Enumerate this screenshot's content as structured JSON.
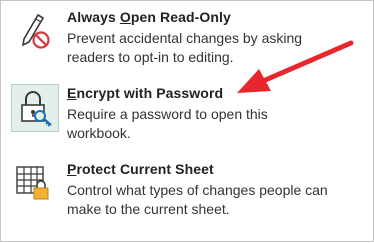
{
  "items": [
    {
      "title_before": "Always ",
      "title_underline": "O",
      "title_after": "pen Read-Only",
      "desc_line1": "Prevent accidental changes by asking",
      "desc_line2": "readers to opt-in to editing.",
      "icon": "pencil-no-icon"
    },
    {
      "title_before": "",
      "title_underline": "E",
      "title_after": "ncrypt with Password",
      "desc_line1": "Require a password to open this",
      "desc_line2": "workbook.",
      "icon": "padlock-key-icon",
      "selected": true
    },
    {
      "title_before": "",
      "title_underline": "P",
      "title_after": "rotect Current Sheet",
      "desc_line1": "Control what types of changes people can",
      "desc_line2": "make to the current sheet.",
      "icon": "sheet-lock-icon"
    }
  ],
  "colors": {
    "annotation_arrow": "#e8262b",
    "selected_bg": "#e3efe9"
  }
}
